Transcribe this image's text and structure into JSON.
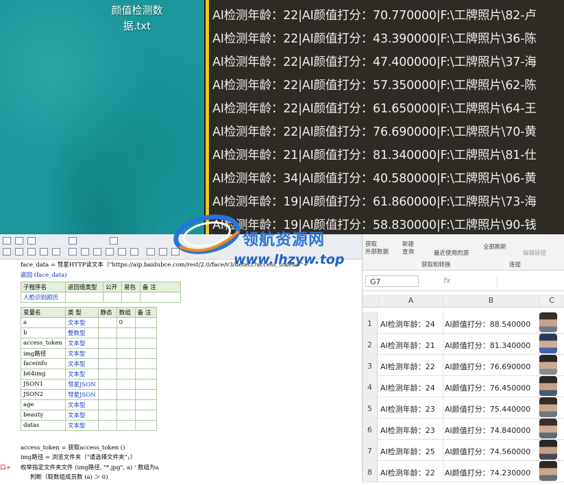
{
  "desktop": {
    "file_label": "颜值检测数据.txt"
  },
  "console": {
    "lines": [
      "AI检测年龄：22|AI颜值打分：70.770000|F:\\工牌照片\\82-卢",
      "AI检测年龄：22|AI颜值打分：43.390000|F:\\工牌照片\\36-陈",
      "AI检测年龄：22|AI颜值打分：47.400000|F:\\工牌照片\\37-海",
      "AI检测年龄：22|AI颜值打分：57.350000|F:\\工牌照片\\62-陈",
      "AI检测年龄：22|AI颜值打分：61.650000|F:\\工牌照片\\64-王",
      "AI检测年龄：22|AI颜值打分：76.690000|F:\\工牌照片\\70-黄",
      "AI检测年龄：21|AI颜值打分：81.340000|F:\\工牌照片\\81-仕",
      "AI检测年龄：34|AI颜值打分：40.580000|F:\\工牌照片\\06-黄",
      "AI检测年龄：19|AI颜值打分：61.860000|F:\\工牌照片\\73-海",
      "AI检测年龄：19|AI颜值打分：58.830000|F:\\工牌照片\\90-钱"
    ]
  },
  "watermark": {
    "name": "领航资源网",
    "url": "www.lhzyw.top"
  },
  "ide": {
    "code_top": [
      "face_data = 彗星HTTP读文本（\"https://aip.baidubce.com/rest/2.0/face/v3/detect?access_token=\"+",
      "返回 (face_data)"
    ],
    "sub_table": {
      "headers": [
        "子程序名",
        "返回值类型",
        "公开",
        "易包",
        "备 注"
      ],
      "row": [
        "人脸识别颜历",
        "",
        "",
        "",
        ""
      ]
    },
    "var_table": {
      "headers": [
        "变量名",
        "类 型",
        "静态",
        "数组",
        "备 注"
      ],
      "rows": [
        [
          "a",
          "文本型",
          "",
          "0",
          ""
        ],
        [
          "b",
          "整数型",
          "",
          "",
          ""
        ],
        [
          "access_token",
          "文本型",
          "",
          "",
          ""
        ],
        [
          "img路径",
          "文本型",
          "",
          "",
          ""
        ],
        [
          "faceinfo",
          "文本型",
          "",
          "",
          ""
        ],
        [
          "b64img",
          "文本型",
          "",
          "",
          ""
        ],
        [
          "JSON1",
          "彗星JSON",
          "",
          "",
          ""
        ],
        [
          "JSON2",
          "彗星JSON",
          "",
          "",
          ""
        ],
        [
          "age",
          "文本型",
          "",
          "",
          ""
        ],
        [
          "beauty",
          "文本型",
          "",
          "",
          ""
        ],
        [
          "datas",
          "文本型",
          "",
          "",
          ""
        ]
      ]
    },
    "code_bottom": [
      "access_token = 获取access_token ()",
      "img路径 = 浏览文件夹（\"请选择文件夹\"，）",
      "枚举指定文件夹文件 (img路径, \"*.jpg\", a) ' 数组为a",
      "判断（取数组成员数 (a) ＞ 0)"
    ],
    "gutter_mark": "口+"
  },
  "sheet": {
    "ribbon": {
      "get_data": "获取\n外部数据",
      "new_query": "新建\n查询",
      "recent_sources": "最近使用的源",
      "group_get_transform": "获取和转换",
      "refresh_all": "全部刷新",
      "edit_links": "编辑链接",
      "group_connections": "连接"
    },
    "name_box": "G7",
    "fx": "fx",
    "columns": [
      "A",
      "B",
      "C"
    ],
    "rows": [
      {
        "n": "1",
        "a": "AI检测年龄：24",
        "b": "AI颜值打分：88.540000"
      },
      {
        "n": "2",
        "a": "AI检测年龄：21",
        "b": "AI颜值打分：81.340000"
      },
      {
        "n": "3",
        "a": "AI检测年龄：22",
        "b": "AI颜值打分：76.690000"
      },
      {
        "n": "4",
        "a": "AI检测年龄：24",
        "b": "AI颜值打分：76.450000"
      },
      {
        "n": "5",
        "a": "AI检测年龄：23",
        "b": "AI颜值打分：75.440000"
      },
      {
        "n": "6",
        "a": "AI检测年龄：23",
        "b": "AI颜值打分：74.840000"
      },
      {
        "n": "7",
        "a": "AI检测年龄：25",
        "b": "AI颜值打分：74.560000"
      },
      {
        "n": "8",
        "a": "AI检测年龄：22",
        "b": "AI颜值打分：74.230000"
      }
    ]
  },
  "colors": {
    "console_bg": "#2d2b24",
    "console_accent": "#f3c624",
    "desktop_teal": "#1b979b",
    "watermark_blue": "#2a73d8"
  }
}
